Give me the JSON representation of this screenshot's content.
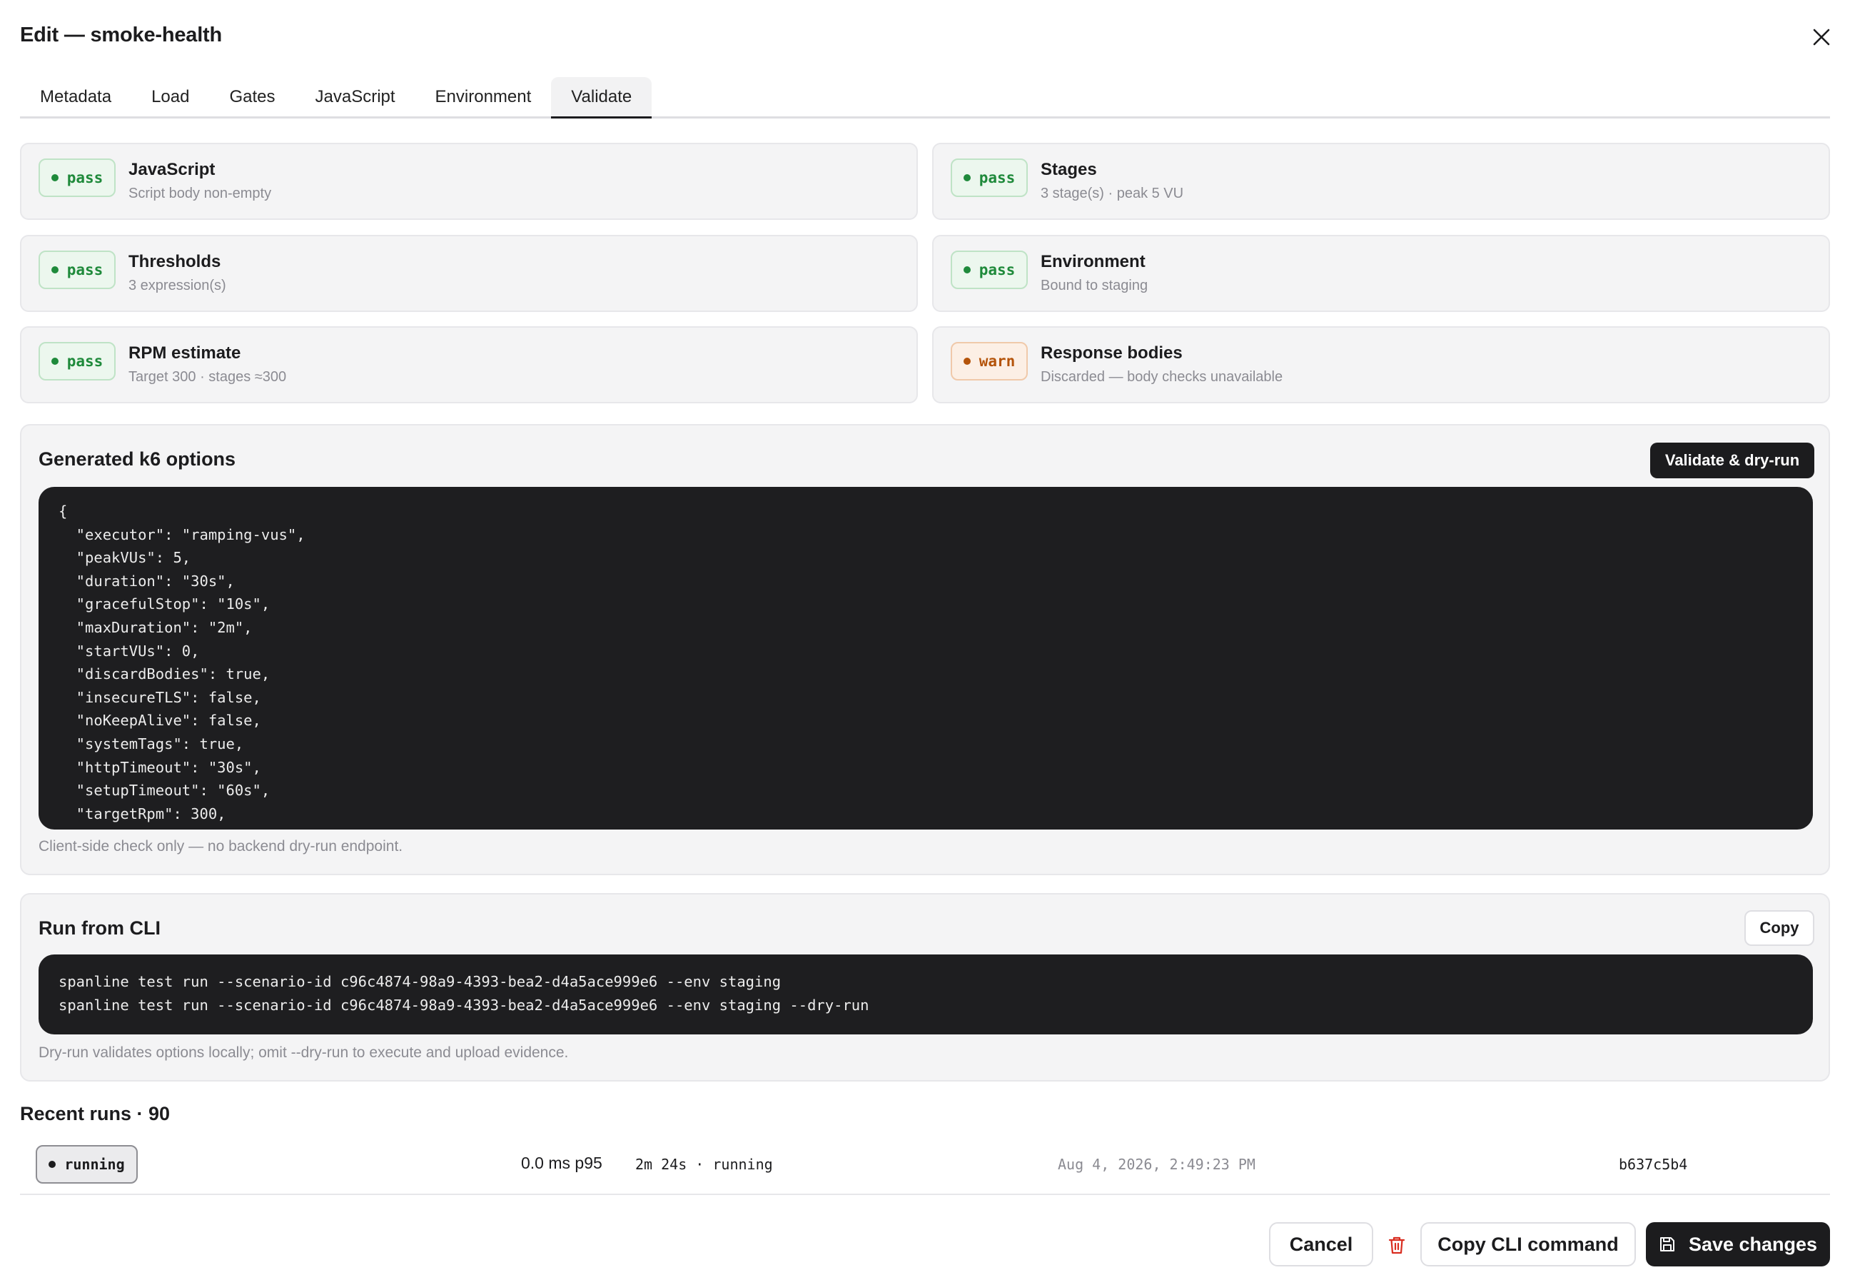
{
  "dialog": {
    "title": "Edit — smoke-health"
  },
  "tabs": [
    {
      "label": "Metadata"
    },
    {
      "label": "Load"
    },
    {
      "label": "Gates"
    },
    {
      "label": "JavaScript"
    },
    {
      "label": "Environment"
    },
    {
      "label": "Validate",
      "active": true
    }
  ],
  "checks": [
    {
      "status": "pass",
      "title": "JavaScript",
      "detail": "Script body non-empty"
    },
    {
      "status": "pass",
      "title": "Stages",
      "detail": "3 stage(s) · peak 5 VU"
    },
    {
      "status": "pass",
      "title": "Thresholds",
      "detail": "3 expression(s)"
    },
    {
      "status": "pass",
      "title": "Environment",
      "detail": "Bound to staging"
    },
    {
      "status": "pass",
      "title": "RPM estimate",
      "detail": "Target 300 · stages ≈300"
    },
    {
      "status": "warn",
      "title": "Response bodies",
      "detail": "Discarded — body checks unavailable"
    }
  ],
  "options_panel": {
    "title": "Generated k6 options",
    "action_label": "Validate & dry-run",
    "code": "{\n  \"executor\": \"ramping-vus\",\n  \"peakVUs\": 5,\n  \"duration\": \"30s\",\n  \"gracefulStop\": \"10s\",\n  \"maxDuration\": \"2m\",\n  \"startVUs\": 0,\n  \"discardBodies\": true,\n  \"insecureTLS\": false,\n  \"noKeepAlive\": false,\n  \"systemTags\": true,\n  \"httpTimeout\": \"30s\",\n  \"setupTimeout\": \"60s\",\n  \"targetRpm\": 300,",
    "hint": "Client-side check only — no backend dry-run endpoint."
  },
  "cli_panel": {
    "title": "Run from CLI",
    "copy_label": "Copy",
    "code": "spanline test run --scenario-id c96c4874-98a9-4393-bea2-d4a5ace999e6 --env staging\nspanline test run --scenario-id c96c4874-98a9-4393-bea2-d4a5ace999e6 --env staging --dry-run",
    "hint": "Dry-run validates options locally; omit --dry-run to execute and upload evidence."
  },
  "recent_runs": {
    "title": "Recent runs · 90",
    "rows": [
      {
        "status": "running",
        "p95": "0.0 ms p95",
        "elapsed": "2m 24s · running",
        "timestamp": "Aug 4, 2026, 2:49:23 PM",
        "id": "b637c5b4"
      }
    ]
  },
  "footer": {
    "cancel_label": "Cancel",
    "copy_cli_label": "Copy CLI command",
    "save_label": "Save changes"
  },
  "colors": {
    "pass": "#1f8a3b",
    "warn": "#b45309",
    "delete": "#d92d20",
    "primary": "#1c1c1e"
  },
  "icons": [
    "close-icon",
    "trash-icon",
    "save-icon"
  ]
}
